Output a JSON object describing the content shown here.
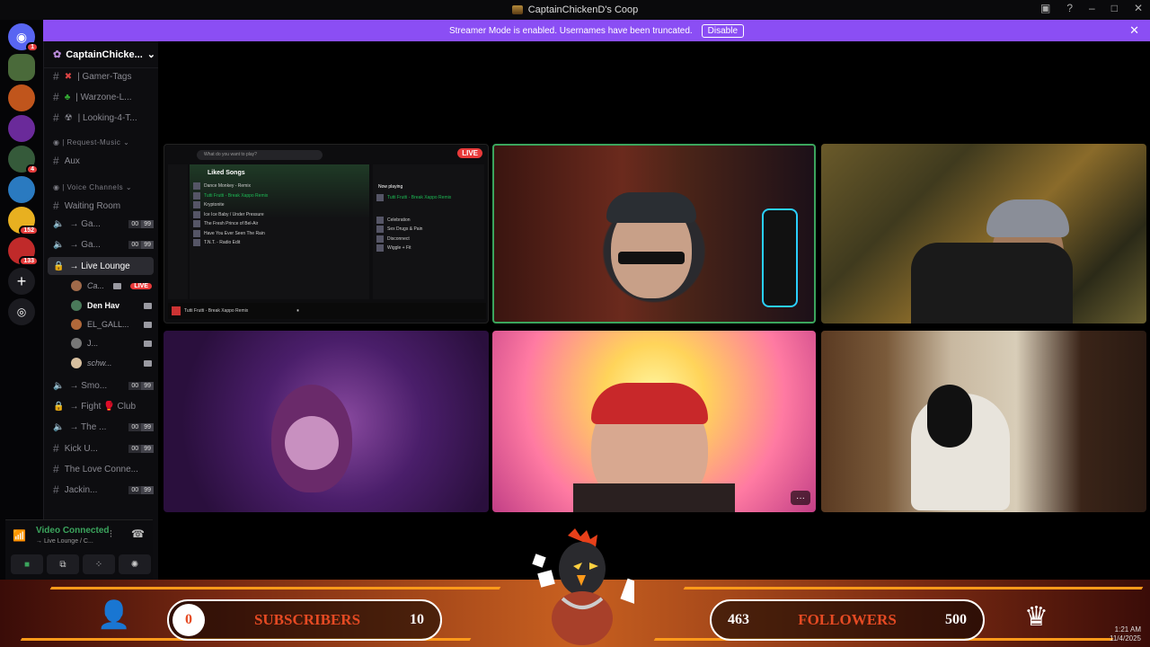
{
  "window": {
    "title": "CaptainChickenD's Coop"
  },
  "banner": {
    "text": "Streamer Mode is enabled. Usernames have been truncated.",
    "button": "Disable"
  },
  "rail": {
    "servers": [
      {
        "name": "discord-home",
        "badge": "1",
        "color": "#5865f2"
      },
      {
        "name": "server-1",
        "badge": "",
        "color": "#4a6a3a"
      },
      {
        "name": "server-2",
        "badge": "",
        "color": "#c0551c"
      },
      {
        "name": "server-3",
        "badge": "",
        "color": "#6a2a9a"
      },
      {
        "name": "server-4",
        "badge": "4",
        "color": "#355a3a"
      },
      {
        "name": "server-5",
        "badge": "",
        "color": "#2a7ac0"
      },
      {
        "name": "server-6",
        "badge": "152",
        "color": "#e8b020"
      },
      {
        "name": "server-7",
        "badge": "133",
        "color": "#c02a2a"
      }
    ]
  },
  "sidebar": {
    "server_name": "CaptainChicke...",
    "channels": [
      {
        "label": "| Gamer-Tags",
        "icon": "#"
      },
      {
        "label": "| Warzone-L...",
        "icon": "#"
      },
      {
        "label": "| Looking-4-T...",
        "icon": "#"
      }
    ],
    "category_music": "| Request-Music",
    "aux": "Aux",
    "category_voice": "Voice Channels",
    "voice": [
      {
        "label": "Waiting Room",
        "a": "",
        "b": ""
      },
      {
        "label": "→ Ga...",
        "a": "00",
        "b": "99"
      },
      {
        "label": "→ Ga...",
        "a": "00",
        "b": "99"
      },
      {
        "label": "→ Live Lounge",
        "a": "",
        "b": ""
      },
      {
        "label": "→ Smo...",
        "a": "00",
        "b": "99"
      },
      {
        "label": "→ Fight 🥊 Club",
        "a": "",
        "b": ""
      },
      {
        "label": "→ The ...",
        "a": "00",
        "b": "99"
      },
      {
        "label": "Kick U...",
        "a": "00",
        "b": "99"
      },
      {
        "label": "The Love Conne...",
        "a": "",
        "b": ""
      },
      {
        "label": "Jackin...",
        "a": "00",
        "b": "99"
      }
    ],
    "users": [
      {
        "name": "Ca...",
        "live": "LIVE"
      },
      {
        "name": "Den Hav",
        "live": ""
      },
      {
        "name": "EL_GALL...",
        "live": ""
      },
      {
        "name": "J...",
        "live": ""
      },
      {
        "name": "schw...",
        "live": ""
      }
    ],
    "voice_status": "Video Connected",
    "voice_sub": "→ Live Lounge / C..."
  },
  "tiles": {
    "live_label": "LIVE",
    "spotify": {
      "search": "What do you want to play?",
      "playlist": "Liked Songs",
      "songs": [
        "Dance Monkey - Remix",
        "Tutti Frutti - Break Xappo Remix",
        "Kryptonite",
        "Ice Ice Baby / Under Pressure",
        "The Fresh Prince of Bel-Air",
        "Have You Ever Seen The Rain",
        "T.N.T. - Radio Edit"
      ],
      "queue_title": "Now playing",
      "queue": [
        "Celebration",
        "Sex Drugs & Pain",
        "Disconnect",
        "Wiggle + Fit"
      ],
      "now_playing": "Tutti Frutti - Break Xappo Remix"
    }
  },
  "overlay": {
    "subs_current": "0",
    "subs_label": "SUBSCRIBERS",
    "subs_goal": "10",
    "followers_current": "463",
    "followers_label": "FOLLOWERS",
    "followers_goal": "500"
  },
  "clock": {
    "time": "1:21 AM",
    "date": "11/4/2025"
  }
}
